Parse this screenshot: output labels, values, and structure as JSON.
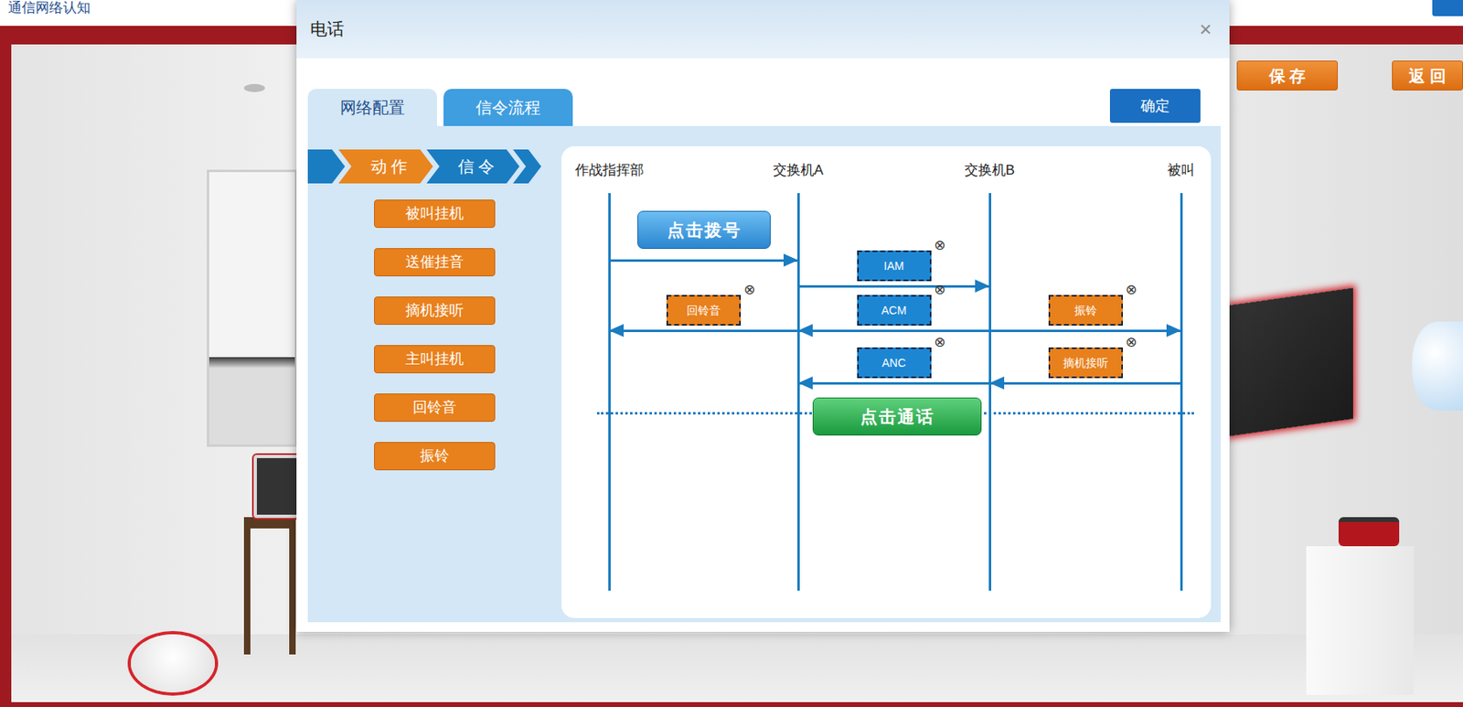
{
  "header": {
    "breadcrumb": "通信网络认知",
    "buttons": [
      {
        "label": "保 存"
      },
      {
        "label": "返 回"
      }
    ]
  },
  "dialog": {
    "title": "电话",
    "close": "×",
    "tabs": [
      {
        "label": "网络配置",
        "selected": true
      },
      {
        "label": "信令流程",
        "selected": false
      }
    ],
    "confirm": "确定",
    "palette": {
      "steps": [
        "动 作",
        "信 令"
      ],
      "items": [
        "被叫挂机",
        "送催挂音",
        "摘机接听",
        "主叫挂机",
        "回铃音",
        "振铃"
      ]
    },
    "diagram": {
      "lanes": [
        "作战指挥部",
        "交换机A",
        "交换机B",
        "被叫"
      ],
      "dial_button": "点击拨号",
      "talk_button": "点击通话",
      "arrows": [
        {
          "from": 0,
          "to": 1,
          "row": 0
        },
        {
          "from": 1,
          "to": 2,
          "row": 1
        },
        {
          "from": 1,
          "to": 0,
          "row": 2
        },
        {
          "from": 2,
          "to": 1,
          "row": 2
        },
        {
          "from": 2,
          "to": 3,
          "row": 2
        },
        {
          "from": 2,
          "to": 1,
          "row": 3
        },
        {
          "from": 3,
          "to": 2,
          "row": 3
        }
      ],
      "placed": [
        {
          "label": "IAM",
          "kind": "signal",
          "between": [
            1,
            2
          ],
          "row": 1,
          "remove": "⊗"
        },
        {
          "label": "回铃音",
          "kind": "action",
          "between": [
            0,
            1
          ],
          "row": 2,
          "remove": "⊗"
        },
        {
          "label": "ACM",
          "kind": "signal",
          "between": [
            1,
            2
          ],
          "row": 2,
          "remove": "⊗"
        },
        {
          "label": "振铃",
          "kind": "action",
          "between": [
            2,
            3
          ],
          "row": 2,
          "remove": "⊗"
        },
        {
          "label": "ANC",
          "kind": "signal",
          "between": [
            1,
            2
          ],
          "row": 3,
          "remove": "⊗"
        },
        {
          "label": "摘机接听",
          "kind": "action",
          "between": [
            2,
            3
          ],
          "row": 3,
          "remove": "⊗"
        }
      ]
    }
  }
}
